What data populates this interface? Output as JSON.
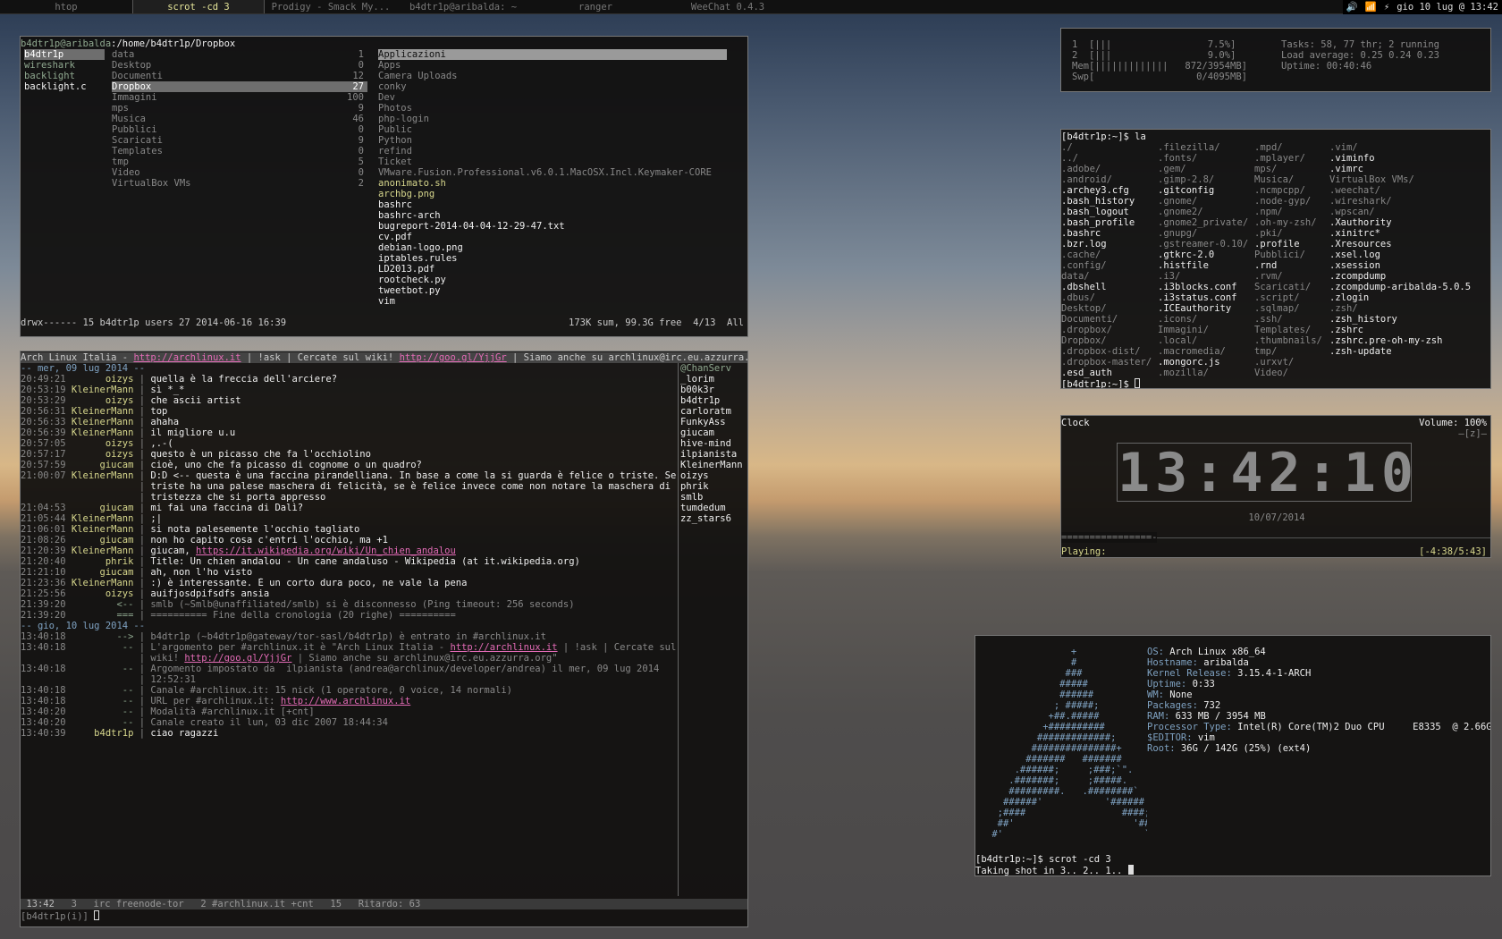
{
  "topbar": {
    "tabs": [
      "htop",
      "scrot -cd 3",
      "Prodigy - Smack My...",
      "b4dtr1p@aribalda: ~",
      "ranger",
      "WeeChat 0.4.3"
    ],
    "active_index": 1,
    "clock": "gio 10 lug @ 13:42",
    "tray": [
      "🔊",
      "📶",
      "⚡"
    ]
  },
  "ranger": {
    "path_user": "b4dtr1p@aribalda",
    "path_dir": ":/home/b4dtr1p/",
    "path_cur": "Dropbox",
    "col1": [
      "b4dtr1p",
      "wireshark",
      "backlight",
      "backlight.c"
    ],
    "col2": [
      {
        "name": "data",
        "n": "1"
      },
      {
        "name": "Desktop",
        "n": "0"
      },
      {
        "name": "Documenti",
        "n": "12"
      },
      {
        "name": "Dropbox",
        "n": "27"
      },
      {
        "name": "Immagini",
        "n": "100"
      },
      {
        "name": "mps",
        "n": "9"
      },
      {
        "name": "Musica",
        "n": "46"
      },
      {
        "name": "Pubblici",
        "n": "0"
      },
      {
        "name": "Scaricati",
        "n": "9"
      },
      {
        "name": "Templates",
        "n": "0"
      },
      {
        "name": "tmp",
        "n": "5"
      },
      {
        "name": "Video",
        "n": "0"
      },
      {
        "name": "VirtualBox VMs",
        "n": "2"
      }
    ],
    "col3_dirs": [
      "Applicazioni",
      "Apps",
      "Camera Uploads",
      "conky",
      "Dev",
      "Photos",
      "php-login",
      "Public",
      "Python",
      "refind",
      "Ticket",
      "VMware.Fusion.Professional.v6.0.1.MacOSX.Incl.Keymaker-CORE"
    ],
    "col3_files": [
      "anonimato.sh",
      "archbg.png",
      "bashrc",
      "bashrc-arch",
      "bugreport-2014-04-04-12-29-47.txt",
      "cv.pdf",
      "debian-logo.png",
      "iptables.rules",
      "LD2013.pdf",
      "rootcheck.py",
      "tweetbot.py",
      "vim"
    ],
    "status_left": "drwx------ 15 b4dtr1p users 27 2014-06-16 16:39",
    "status_right": "173K sum, 99.3G free  4/13  All"
  },
  "htop": {
    "lines": [
      "1  [|||                 7.5%]",
      "2  [|||                 9.0%]",
      "Mem[|||||||||||||   872/3954MB]",
      "Swp[                  0/4095MB]"
    ],
    "info": [
      "Tasks: 58, 77 thr; 2 running",
      "Load average: 0.25 0.24 0.23",
      "Uptime: 00:40:46"
    ]
  },
  "ls": {
    "prompt": "[b4dtr1p:~]$ la",
    "prompt2": "[b4dtr1p:~]$ ",
    "col1": [
      "./",
      "../",
      ".adobe/",
      ".android/",
      ".archey3.cfg",
      ".bash_history",
      ".bash_logout",
      ".bash_profile",
      ".bashrc",
      ".bzr.log",
      ".cache/",
      ".config/",
      "data/",
      ".dbshell",
      ".dbus/",
      "Desktop/",
      "Documenti/",
      ".dropbox/",
      "Dropbox/",
      ".dropbox-dist/",
      ".dropbox-master/",
      ".esd_auth"
    ],
    "col2": [
      ".filezilla/",
      ".fonts/",
      ".gem/",
      ".gimp-2.8/",
      ".gitconfig",
      ".gnome/",
      ".gnome2/",
      ".gnome2_private/",
      ".gnupg/",
      ".gstreamer-0.10/",
      ".gtkrc-2.0",
      ".histfile",
      ".i3/",
      ".i3blocks.conf",
      ".i3status.conf",
      ".ICEauthority",
      ".icons/",
      "Immagini/",
      ".local/",
      ".macromedia/",
      ".mongorc.js",
      ".mozilla/"
    ],
    "col3": [
      ".mpd/",
      ".mplayer/",
      "mps/",
      "Musica/",
      ".ncmpcpp/",
      ".node-gyp/",
      ".npm/",
      ".oh-my-zsh/",
      ".pki/",
      ".profile",
      "Pubblici/",
      ".rnd",
      ".rvm/",
      "Scaricati/",
      ".script/",
      ".sqlmap/",
      ".ssh/",
      "Templates/",
      ".thumbnails/",
      "tmp/",
      ".urxvt/",
      "Video/"
    ],
    "col4": [
      ".vim/",
      ".viminfo",
      ".vimrc",
      "VirtualBox VMs/",
      ".weechat/",
      ".wireshark/",
      ".wpscan/",
      ".Xauthority",
      ".xinitrc*",
      ".Xresources",
      ".xsel.log",
      ".xsession",
      ".zcompdump",
      ".zcompdump-aribalda-5.0.5",
      ".zlogin",
      ".zsh/",
      ".zsh_history",
      ".zshrc",
      ".zshrc.pre-oh-my-zsh",
      ".zsh-update"
    ]
  },
  "clockwin": {
    "title": "Clock",
    "volume": "Volume: 100%",
    "z": "—[z]—",
    "time": "13:42:10",
    "date": "10/07/2014",
    "progress": "================-",
    "playing": "Playing:",
    "remaining": "[-4:38/5:43]"
  },
  "archey": {
    "ascii": [
      "               +",
      "               #",
      "              ###",
      "             #####",
      "             ######",
      "            ; #####;",
      "           +##.#####",
      "          +##########",
      "         #############;",
      "        ###############+",
      "       #######   #######",
      "     .######;     ;###;`\".",
      "    .#######;     ;#####.",
      "    #########.   .########`",
      "   ######'           '######",
      "  ;####                 ####;",
      "  ##'                     '##",
      " #'                         `#"
    ],
    "info": [
      {
        "k": "OS:",
        "v": " Arch Linux x86_64"
      },
      {
        "k": "Hostname:",
        "v": " aribalda"
      },
      {
        "k": "Kernel Release:",
        "v": " 3.15.4-1-ARCH"
      },
      {
        "k": "Uptime:",
        "v": " 0:33"
      },
      {
        "k": "WM:",
        "v": " None"
      },
      {
        "k": "Packages:",
        "v": " 732"
      },
      {
        "k": "RAM:",
        "v": " 633 MB / 3954 MB"
      },
      {
        "k": "Processor Type:",
        "v": " Intel(R) Core(TM)2 Duo CPU     E8335  @ 2.66GHz"
      },
      {
        "k": "$EDITOR:",
        "v": " vim"
      },
      {
        "k": "Root:",
        "v": " 36G / 142G (25%) (ext4)"
      }
    ],
    "prompt": "[b4dtr1p:~]$ scrot -cd 3",
    "taking": "Taking shot in 3.. 2.. 1.. "
  },
  "weechat": {
    "topic_a": "Arch Linux Italia - ",
    "topic_link1": "http://archlinux.it",
    "topic_b": " | !ask | Cercate sul wiki! ",
    "topic_link2": "http://goo.gl/YjjGr",
    "topic_c": " | Siamo anche su archlinux@irc.eu.azzurra.org",
    "lines": [
      {
        "t": "-- mer, 09 lug 2014 --",
        "n": "",
        "m": "",
        "c": "day"
      },
      {
        "t": "20:49:21",
        "n": "oizys",
        "m": "quella è la freccia dell'arciere?"
      },
      {
        "t": "20:53:19",
        "n": "KleinerMann",
        "m": "sì *_*"
      },
      {
        "t": "20:53:29",
        "n": "oizys",
        "m": "che ascii artist"
      },
      {
        "t": "20:56:31",
        "n": "KleinerMann",
        "m": "top"
      },
      {
        "t": "20:56:33",
        "n": "KleinerMann",
        "m": "ahaha"
      },
      {
        "t": "20:56:39",
        "n": "KleinerMann",
        "m": "il migliore u.u"
      },
      {
        "t": "20:57:05",
        "n": "oizys",
        "m": ",.-("
      },
      {
        "t": "20:57:17",
        "n": "oizys",
        "m": "questo è un picasso che fa l'occhiolino"
      },
      {
        "t": "20:57:59",
        "n": "giucam",
        "m": "cioè, uno che fa picasso di cognome o un quadro?"
      },
      {
        "t": "21:00:07",
        "n": "KleinerMann",
        "m": "D:D <-- questa è una faccina pirandelliana. In base a come la si guarda è felice o triste. Se è"
      },
      {
        "t": "",
        "n": "",
        "m": "triste ha una palese maschera di felicità, se è felice invece come non notare la maschera di"
      },
      {
        "t": "",
        "n": "",
        "m": "tristezza che si porta appresso"
      },
      {
        "t": "21:04:53",
        "n": "giucam",
        "m": "mi fai una faccina di Dalì?"
      },
      {
        "t": "21:05:44",
        "n": "KleinerMann",
        "m": ";|"
      },
      {
        "t": "21:06:01",
        "n": "KleinerMann",
        "m": "si nota palesemente l'occhio tagliato"
      },
      {
        "t": "21:08:26",
        "n": "giucam",
        "m": "non ho capito cosa c'entri l'occhio, ma +1"
      },
      {
        "t": "21:20:39",
        "n": "KleinerMann",
        "m": "giucam, ",
        "link": "https://it.wikipedia.org/wiki/Un_chien_andalou"
      },
      {
        "t": "21:20:40",
        "n": "phrik",
        "m": "Title: Un chien andalou - Un cane andaluso - Wikipedia (at it.wikipedia.org)"
      },
      {
        "t": "21:21:10",
        "n": "giucam",
        "m": "ah, non l'ho visto"
      },
      {
        "t": "21:23:36",
        "n": "KleinerMann",
        "m": ":) è interessante. È un corto dura poco, ne vale la pena"
      },
      {
        "t": "21:25:56",
        "n": "oizys",
        "m": "auifjosdpifsdfs ansia"
      },
      {
        "t": "21:39:20",
        "n": "<--",
        "m": "smlb (~Smlb@unaffiliated/smlb) si è disconnesso (Ping timeout: 256 seconds)",
        "c": "sys"
      },
      {
        "t": "21:39:20",
        "n": "===",
        "m": "========== Fine della cronologia (20 righe) ==========",
        "c": "sys"
      },
      {
        "t": "-- gio, 10 lug 2014 --",
        "n": "",
        "m": "",
        "c": "day"
      },
      {
        "t": "13:40:18",
        "n": "-->",
        "m": "b4dtr1p (~b4dtr1p@gateway/tor-sasl/b4dtr1p) è entrato in #archlinux.it",
        "c": "sys"
      },
      {
        "t": "13:40:18",
        "n": "--",
        "m": "L'argomento per #archlinux.it è \"Arch Linux Italia - ",
        "link": "http://archlinux.it",
        "m2": " | !ask | Cercate sul",
        "c": "sys"
      },
      {
        "t": "",
        "n": "",
        "m": "wiki! ",
        "link": "http://goo.gl/YjjGr",
        "m2": " | Siamo anche su archlinux@irc.eu.azzurra.org\"",
        "c": "sys"
      },
      {
        "t": "13:40:18",
        "n": "--",
        "m": "Argomento impostato da  ilpianista (andrea@archlinux/developer/andrea) il mer, 09 lug 2014",
        "c": "sys"
      },
      {
        "t": "",
        "n": "",
        "m": "12:52:31",
        "c": "sys"
      },
      {
        "t": "13:40:18",
        "n": "--",
        "m": "Canale #archlinux.it: 15 nick (1 operatore, 0 voice, 14 normali)",
        "c": "sys"
      },
      {
        "t": "13:40:18",
        "n": "--",
        "m": "URL per #archlinux.it: ",
        "link": "http://www.archlinux.it",
        "c": "sys"
      },
      {
        "t": "13:40:20",
        "n": "--",
        "m": "Modalità #archlinux.it [+cnt]",
        "c": "sys"
      },
      {
        "t": "13:40:20",
        "n": "--",
        "m": "Canale creato il lun, 03 dic 2007 18:44:34",
        "c": "sys"
      },
      {
        "t": "13:40:39",
        "n": "b4dtr1p",
        "m": "ciao ragazzi"
      }
    ],
    "nicks": [
      "@ChanServ",
      "_lorim",
      "b00k3r",
      "b4dtr1p",
      "carloratm",
      "FunkyAss",
      "giucam",
      "hive-mind",
      "ilpianista",
      "KleinerMann",
      "oizys",
      "phrik",
      "smlb",
      "tumdedum",
      "zz_stars6"
    ],
    "statusbar": [
      "13:42",
      "3",
      "irc freenode-tor",
      "2 #archlinux.it +cnt",
      "15",
      "Ritardo: 63"
    ],
    "input_prompt": "[b4dtr1p(i)] "
  }
}
